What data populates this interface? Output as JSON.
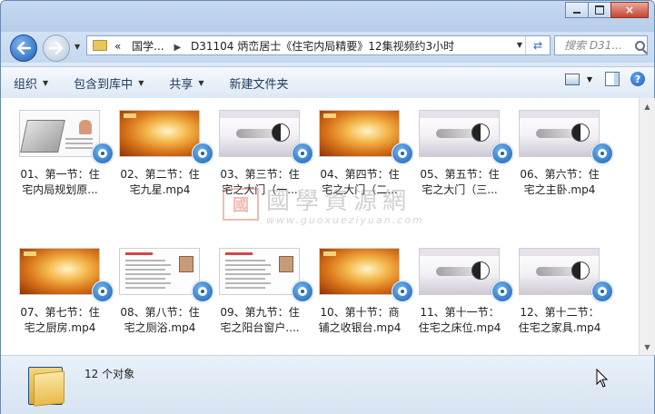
{
  "window": {
    "caption_buttons": {
      "minimize": "minimize",
      "maximize": "maximize",
      "close": "×"
    }
  },
  "nav": {
    "address": {
      "overflow": "«",
      "segments": [
        "国学...",
        "D31104 炳峦居士《住宅内局精要》12集视频约3小时"
      ]
    },
    "search_placeholder": "搜索 D31..."
  },
  "toolbar": {
    "items": [
      {
        "label": "组织",
        "has_dropdown": true
      },
      {
        "label": "包含到库中",
        "has_dropdown": true
      },
      {
        "label": "共享",
        "has_dropdown": true
      },
      {
        "label": "新建文件夹",
        "has_dropdown": false
      }
    ]
  },
  "watermark": {
    "seal": "國",
    "text": "國學資源網",
    "url": "www.guoxueziyuan.com"
  },
  "files": [
    {
      "line1": "01、第一节：住",
      "line2": "宅内局规划原...",
      "thumb": "room"
    },
    {
      "line1": "02、第二节：住",
      "line2": "宅九星.mp4",
      "thumb": "gold"
    },
    {
      "line1": "03、第三节：住",
      "line2": "宅之大门（一...",
      "thumb": "ppt"
    },
    {
      "line1": "04、第四节：住",
      "line2": "宅之大门（二...",
      "thumb": "gold"
    },
    {
      "line1": "05、第五节：住",
      "line2": "宅之大门（三...",
      "thumb": "ppt"
    },
    {
      "line1": "06、第六节：住",
      "line2": "宅之主卧.mp4",
      "thumb": "ppt"
    },
    {
      "line1": "07、第七节：住",
      "line2": "宅之厨房.mp4",
      "thumb": "gold"
    },
    {
      "line1": "08、第八节：住",
      "line2": "宅之厕浴.mp4",
      "thumb": "doc"
    },
    {
      "line1": "09、第九节：住",
      "line2": "宅之阳台窗户....",
      "thumb": "doc"
    },
    {
      "line1": "10、第十节：商",
      "line2": "铺之收银台.mp4",
      "thumb": "gold"
    },
    {
      "line1": "11、第十一节：",
      "line2": "住宅之床位.mp4",
      "thumb": "ppt"
    },
    {
      "line1": "12、第十二节：",
      "line2": "住宅之家具.mp4",
      "thumb": "ppt"
    }
  ],
  "status": {
    "count": "12 个对象"
  }
}
